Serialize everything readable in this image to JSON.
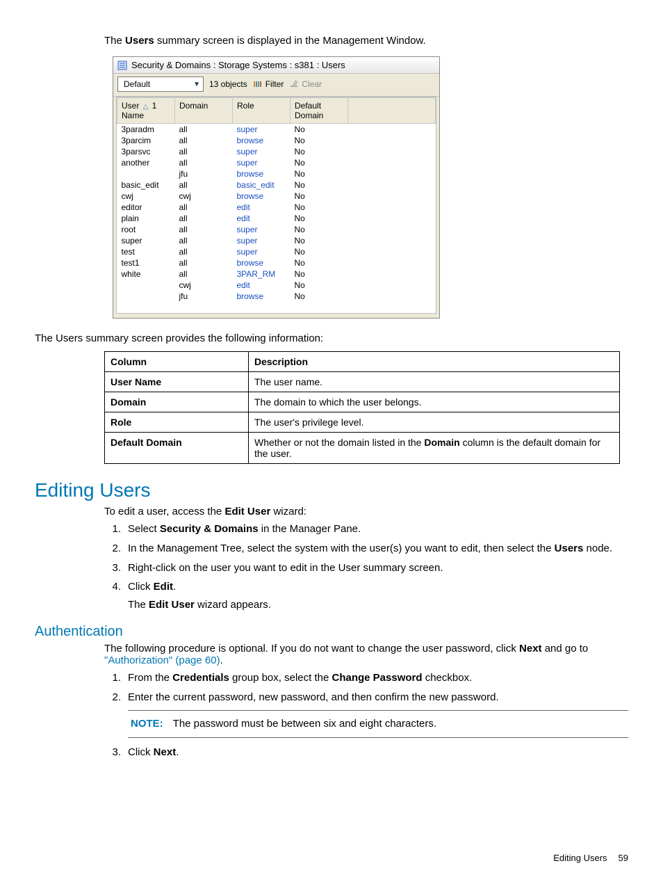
{
  "intro": {
    "prefix": "The ",
    "bold": "Users",
    "suffix": " summary screen is displayed in the Management Window."
  },
  "window": {
    "title": "Security & Domains : Storage Systems : s381 : Users",
    "dropdown_value": "Default",
    "objects_label": "13 objects",
    "filter_label": "Filter",
    "clear_label": "Clear",
    "columns": {
      "user_name_l1": "User",
      "user_name_l2": "Name",
      "sort_indicator": "1",
      "domain": "Domain",
      "role": "Role",
      "default_domain_l1": "Default",
      "default_domain_l2": "Domain"
    },
    "rows": [
      {
        "user": "3paradm",
        "domain": "all",
        "role": "super",
        "dd": "No"
      },
      {
        "user": "3parcim",
        "domain": "all",
        "role": "browse",
        "dd": "No"
      },
      {
        "user": "3parsvc",
        "domain": "all",
        "role": "super",
        "dd": "No"
      },
      {
        "user": "another",
        "domain": "all",
        "role": "super",
        "dd": "No"
      },
      {
        "user": "",
        "domain": "jfu",
        "role": "browse",
        "dd": "No"
      },
      {
        "user": "basic_edit",
        "domain": "all",
        "role": "basic_edit",
        "dd": "No"
      },
      {
        "user": "cwj",
        "domain": "cwj",
        "role": "browse",
        "dd": "No"
      },
      {
        "user": "editor",
        "domain": "all",
        "role": "edit",
        "dd": "No"
      },
      {
        "user": "plain",
        "domain": "all",
        "role": "edit",
        "dd": "No"
      },
      {
        "user": "root",
        "domain": "all",
        "role": "super",
        "dd": "No"
      },
      {
        "user": "super",
        "domain": "all",
        "role": "super",
        "dd": "No"
      },
      {
        "user": "test",
        "domain": "all",
        "role": "super",
        "dd": "No"
      },
      {
        "user": "test1",
        "domain": "all",
        "role": "browse",
        "dd": "No"
      },
      {
        "user": "white",
        "domain": "all",
        "role": "3PAR_RM",
        "dd": "No"
      },
      {
        "user": "",
        "domain": "cwj",
        "role": "edit",
        "dd": "No"
      },
      {
        "user": "",
        "domain": "jfu",
        "role": "browse",
        "dd": "No"
      }
    ]
  },
  "after_window": "The Users summary screen provides the following information:",
  "desc_table": {
    "headers": {
      "c1": "Column",
      "c2": "Description"
    },
    "rows": [
      {
        "c1": "User Name",
        "c2": "The user name."
      },
      {
        "c1": "Domain",
        "c2": "The domain to which the user belongs."
      },
      {
        "c1": "Role",
        "c2": "The user's privilege level."
      },
      {
        "c1": "Default Domain",
        "c2_pre": "Whether or not the domain listed in the ",
        "c2_bold": "Domain",
        "c2_post": " column is the default domain for the user."
      }
    ]
  },
  "editing_users": {
    "heading": "Editing Users",
    "lead_pre": "To edit a user, access the ",
    "lead_bold": "Edit User",
    "lead_post": " wizard:",
    "steps": {
      "s1_pre": "Select ",
      "s1_bold": "Security & Domains",
      "s1_post": " in the Manager Pane.",
      "s2_pre": "In the Management Tree, select the system with the user(s) you want to edit, then select the ",
      "s2_bold": "Users",
      "s2_post": " node.",
      "s3": "Right-click on the user you want to edit in the User summary screen.",
      "s4_pre": "Click ",
      "s4_bold": "Edit",
      "s4_post": ".",
      "s4_after_pre": "The ",
      "s4_after_bold": "Edit User",
      "s4_after_post": " wizard appears."
    }
  },
  "authentication": {
    "heading": "Authentication",
    "lead_pre": "The following procedure is optional. If you do not want to change the user password, click ",
    "lead_bold": "Next",
    "lead_post": " and go to ",
    "lead_link": "\"Authorization\" (page 60)",
    "lead_end": ".",
    "steps": {
      "s1_pre": "From the ",
      "s1_b1": "Credentials",
      "s1_mid": " group box, select the ",
      "s1_b2": "Change Password",
      "s1_post": " checkbox.",
      "s2": "Enter the current password, new password, and then confirm the new password.",
      "note_label": "NOTE:",
      "note_text": "The password must be between six and eight characters.",
      "s3_pre": "Click ",
      "s3_bold": "Next",
      "s3_post": "."
    }
  },
  "footer": {
    "section": "Editing Users",
    "page": "59"
  }
}
